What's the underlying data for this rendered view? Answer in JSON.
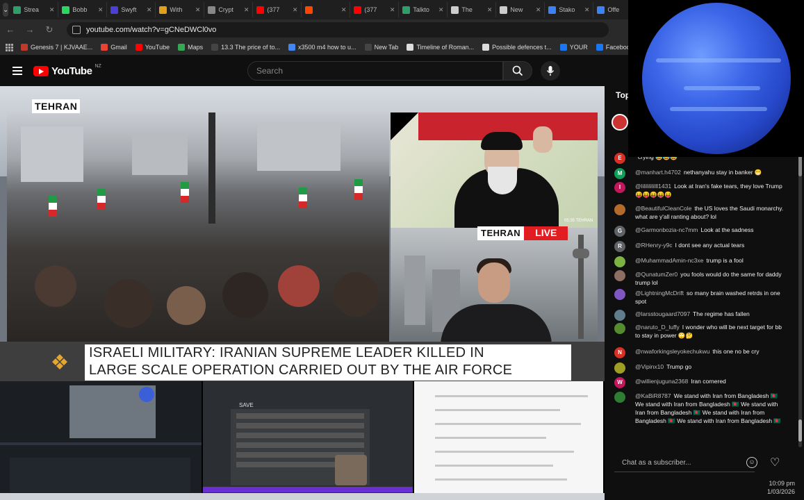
{
  "browser": {
    "tabs": [
      {
        "title": "Strea",
        "color": "#2f9e6a"
      },
      {
        "title": "Bobb",
        "color": "#2bd85f"
      },
      {
        "title": "Swyft",
        "color": "#4b3fd6"
      },
      {
        "title": "With",
        "color": "#e0a019"
      },
      {
        "title": "Crypt",
        "color": "#888888"
      },
      {
        "title": "(377",
        "color": "#ff0000"
      },
      {
        "title": "",
        "color": "#ff4500"
      },
      {
        "title": "(377",
        "color": "#ff0000"
      },
      {
        "title": "Talkto",
        "color": "#2f9e6a"
      },
      {
        "title": "The",
        "color": "#cccccc"
      },
      {
        "title": "New",
        "color": "#cccccc"
      },
      {
        "title": "Stako",
        "color": "#3b82f6"
      },
      {
        "title": "Offe",
        "color": "#3b82f6"
      }
    ],
    "url": "youtube.com/watch?v=gCNeDWCl0vo",
    "bookmarks": [
      {
        "label": "Genesis 7 | KJVAAE...",
        "color": "#c0392b"
      },
      {
        "label": "Gmail",
        "color": "#ea4335"
      },
      {
        "label": "YouTube",
        "color": "#ff0000"
      },
      {
        "label": "Maps",
        "color": "#34a853"
      },
      {
        "label": "13.3 The price of to...",
        "color": "#444444"
      },
      {
        "label": "x3500 m4 how to u...",
        "color": "#4285f4"
      },
      {
        "label": "New Tab",
        "color": "#444444"
      },
      {
        "label": "Timeline of Roman...",
        "color": "#dddddd"
      },
      {
        "label": "Possible defences t...",
        "color": "#dddddd"
      },
      {
        "label": "YOUR",
        "color": "#1877f2"
      },
      {
        "label": "Facebook green",
        "color": "#1877f2"
      }
    ]
  },
  "youtube": {
    "logo_text": "YouTube",
    "region": "NZ",
    "search_placeholder": "Search"
  },
  "video": {
    "location_label": "TEHRAN",
    "live_city": "TEHRAN",
    "live_tag": "LIVE",
    "headline_line1": "ISRAELI MILITARY: IRANIAN SUPREME LEADER KILLED IN",
    "headline_line2": "LARGE SCALE OPERATION CARRIED OUT BY THE AIR FORCE",
    "timestamp": "05:35 TEHRAN"
  },
  "thumbnails": {
    "save_label": "SAVE"
  },
  "chat": {
    "header": "Top",
    "input_placeholder": "Chat as a subscriber...",
    "messages": [
      {
        "author": "",
        "text": "crying 😂😂😂",
        "avatar_letter": "E",
        "avatar_color": "#d93025"
      },
      {
        "author": "@manhart.h4702",
        "text": "nethanyahu stay in banker 😁",
        "avatar_letter": "M",
        "avatar_color": "#0f9d58"
      },
      {
        "author": "@lilililililll1431",
        "text": "Look at Iran's fake tears, they love Trump 😝😝😝😝😝",
        "avatar_letter": "I",
        "avatar_color": "#c2185b"
      },
      {
        "author": "@BeautifulCleanCole",
        "text": "the US loves the Saudi monarchy. what are y'all ranting about? lol",
        "avatar_letter": "",
        "avatar_color": "#b36b2c"
      },
      {
        "author": "@Garmonbozia-nc7mm",
        "text": "Look at the sadness",
        "avatar_letter": "G",
        "avatar_color": "#5f6368"
      },
      {
        "author": "@RHenry-y9c",
        "text": "I dont see any actual tears",
        "avatar_letter": "R",
        "avatar_color": "#5f6368"
      },
      {
        "author": "@MuhammadAmin-nc3xe",
        "text": "trump is a fool",
        "avatar_letter": "",
        "avatar_color": "#7cb342"
      },
      {
        "author": "@QunatumZer0",
        "text": "you fools would do the same for daddy trump lol",
        "avatar_letter": "",
        "avatar_color": "#8d6e63"
      },
      {
        "author": "@LightningMcDrift",
        "text": "so many brain washed retrds in one spot",
        "avatar_letter": "",
        "avatar_color": "#7e57c2"
      },
      {
        "author": "@larsstougaard7097",
        "text": "The regime has fallen",
        "avatar_letter": "",
        "avatar_color": "#607d8b"
      },
      {
        "author": "@naruto_D_luffy",
        "text": "I wonder who will be next target for bb to stay in power 🙄🤔",
        "avatar_letter": "",
        "avatar_color": "#558b2f"
      },
      {
        "author": "@nwaforkingsleyokechukwu",
        "text": "this one no be cry",
        "avatar_letter": "N",
        "avatar_color": "#d93025"
      },
      {
        "author": "@Vipinx10",
        "text": "Trump go",
        "avatar_letter": "",
        "avatar_color": "#9e9d24"
      },
      {
        "author": "@willienjuguna2368",
        "text": "Iran cornered",
        "avatar_letter": "W",
        "avatar_color": "#c2185b"
      },
      {
        "author": "@KaBiR8787",
        "text": "We stand with Iran from Bangladesh 🇧🇩 We stand with Iran from Bangladesh 🇧🇩 We stand with Iran from Bangladesh 🇧🇩 We stand with Iran from Bangladesh 🇧🇩 We stand with Iran from Bangladesh 🇧🇩",
        "avatar_letter": "",
        "avatar_color": "#2e7d32"
      }
    ]
  },
  "system": {
    "time": "10:09 pm",
    "date": "1/03/2026"
  },
  "colors": {
    "youtube_red": "#ff0000",
    "live_red": "#e11d22",
    "aljazeera_gold": "#e5a531"
  }
}
